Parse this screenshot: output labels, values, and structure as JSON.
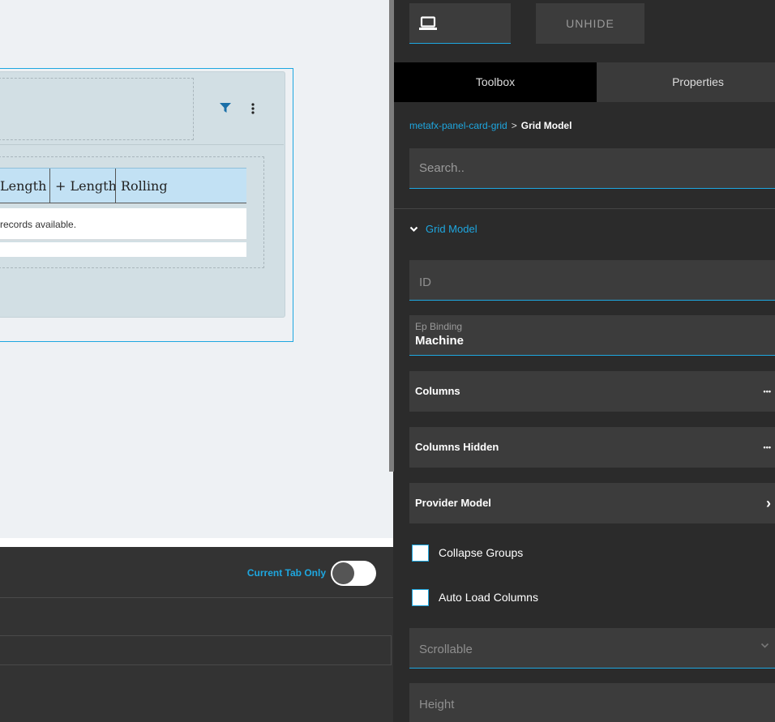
{
  "grid": {
    "columns": [
      "Length",
      "+ Length",
      "Rolling"
    ],
    "empty_message": "records available."
  },
  "bottom": {
    "current_tab_only_label": "Current Tab Only",
    "current_tab_only_on": false
  },
  "toolbar": {
    "unhide_label": "UNHIDE",
    "device_icon": "laptop-icon"
  },
  "tabs": {
    "toolbox": "Toolbox",
    "properties": "Properties"
  },
  "breadcrumb": {
    "parent": "metafx-panel-card-grid",
    "separator": ">",
    "current": "Grid Model"
  },
  "search": {
    "placeholder": "Search.."
  },
  "section": {
    "title": "Grid Model"
  },
  "properties": {
    "id_placeholder": "ID",
    "ep_binding_label": "Ep Binding",
    "ep_binding_value": "Machine",
    "columns_label": "Columns",
    "columns_hidden_label": "Columns Hidden",
    "provider_model_label": "Provider Model",
    "more_glyph": "•••",
    "arrow_glyph": "›",
    "collapse_groups_label": "Collapse Groups",
    "auto_load_columns_label": "Auto Load Columns",
    "scrollable_placeholder": "Scrollable",
    "height_placeholder": "Height"
  },
  "colors": {
    "accent": "#1ea7e0",
    "panel_bg": "#2b2b2b",
    "field_bg": "#3c3c3c",
    "grid_header_bg": "#c2e1f4"
  }
}
